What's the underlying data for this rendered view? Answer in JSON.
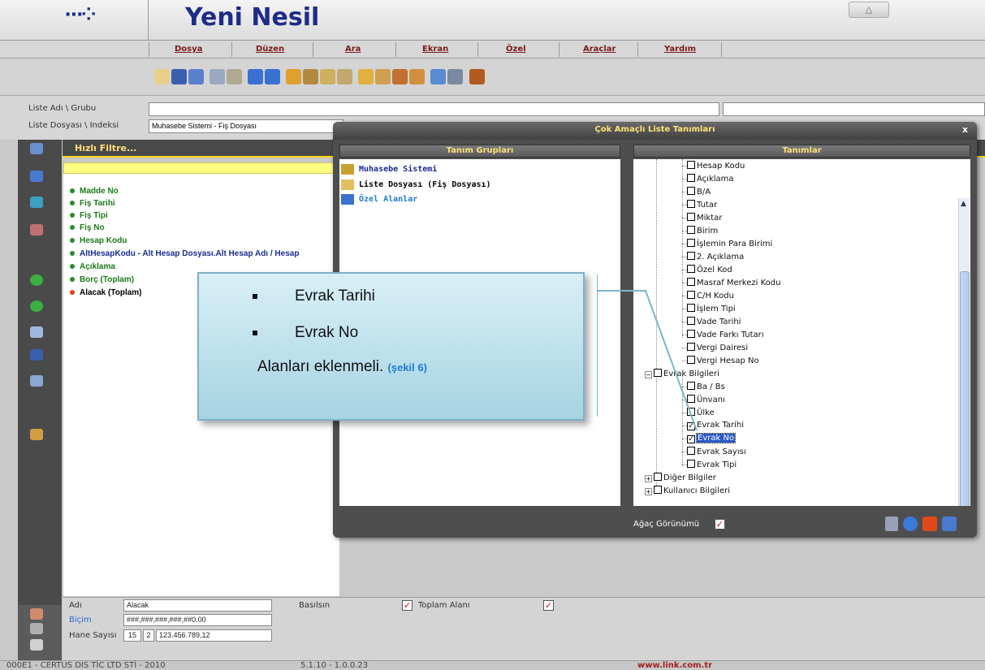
{
  "app": {
    "title": "Yeni Nesil",
    "logo_glyph": "⋯⁘"
  },
  "window": {
    "restore_glyph": "△"
  },
  "menu": [
    "Dosya",
    "Düzen",
    "Ara",
    "Ekran",
    "Özel",
    "Araçlar",
    "Yardım"
  ],
  "form": {
    "liste_adi_label": "Liste Adı \\ Grubu",
    "liste_dosyasi_label": "Liste Dosyası \\ Indeksi",
    "liste_dosyasi_value": "Muhasebe Sistemi - Fiş Dosyası"
  },
  "filter": {
    "label": "Hızlı Filtre..."
  },
  "fields": [
    {
      "label": "Madde No",
      "color": "#1a7a1a"
    },
    {
      "label": "Fiş Tarihi",
      "color": "#1a7a1a"
    },
    {
      "label": "Fiş Tipi",
      "color": "#1a7a1a"
    },
    {
      "label": "Fiş No",
      "color": "#1a7a1a"
    },
    {
      "label": "Hesap Kodu",
      "color": "#1a7a1a"
    },
    {
      "label": "AltHesapKodu - Alt Hesap Dosyası.Alt Hesap Adı / Hesap",
      "color": "#1a2a90"
    },
    {
      "label": "Açıklama",
      "color": "#1a7a1a"
    },
    {
      "label": "Borç  (Toplam)",
      "color": "#1a7a1a"
    },
    {
      "label": "Alacak  (Toplam)",
      "color": "#000000"
    }
  ],
  "dialog": {
    "title": "Çok Amaçlı Liste Tanımları",
    "close": "x",
    "groups_header": "Tanım Grupları",
    "defs_header": "Tanımlar",
    "groups": [
      {
        "label": "Muhasebe Sistemi",
        "color": "#1a2a90"
      },
      {
        "label": "Liste Dosyası (Fiş Dosyası)",
        "color": "#000000"
      },
      {
        "label": "Özel Alanlar",
        "color": "#1f7ad0"
      }
    ],
    "tree_top": [
      "Hesap Kodu",
      "Açıklama",
      "B/A",
      "Tutar",
      "Miktar",
      "Birim",
      "İşlemin Para Birimi",
      "2. Açıklama",
      "Özel Kod",
      "Masraf Merkezi Kodu",
      "C/H Kodu",
      "İşlem Tipi",
      "Vade Tarihi",
      "Vade Farkı Tutarı",
      "Vergi Dairesi",
      "Vergi Hesap No"
    ],
    "evrak_group": "Evrak Bilgileri",
    "evrak_items": [
      {
        "label": "Ba / Bs",
        "checked": false
      },
      {
        "label": "Ünvanı",
        "checked": false
      },
      {
        "label": "Ülke",
        "checked": false
      },
      {
        "label": "Evrak Tarihi",
        "checked": true
      },
      {
        "label": "Evrak No",
        "checked": true,
        "selected": true
      },
      {
        "label": "Evrak Sayısı",
        "checked": false
      },
      {
        "label": "Evrak Tipi",
        "checked": false
      }
    ],
    "other_groups": [
      "Diğer Bilgiler",
      "Kullanıcı Bilgileri"
    ],
    "agac_label": "Ağaç Görünümü",
    "check_glyph": "✓"
  },
  "callout": {
    "items": [
      "Evrak Tarihi",
      "Evrak No"
    ],
    "text": "Alanları eklenmeli.",
    "ref": "(şekil 6)",
    "ref_color": "#1f7ad0"
  },
  "bottom": {
    "adi_label": "Adı",
    "adi_value": "Alacak",
    "basilsin_label": "Basılsın",
    "toplam_label": "Toplam Alanı",
    "bicim_label": "Biçim",
    "bicim_value": "###,###,###,###,##0.00",
    "hane_label": "Hane Sayısı",
    "hane_value1": "15",
    "hane_value2": "2",
    "hane_sample": "123.456.789,12",
    "check_glyph": "✓"
  },
  "status": {
    "left": "000E1 - CERTUS DIS TİC LTD STİ - 2010",
    "version": "5.1.10 - 1.0.0.23",
    "url": "www.link.com.tr",
    "url_color": "#a02020"
  }
}
